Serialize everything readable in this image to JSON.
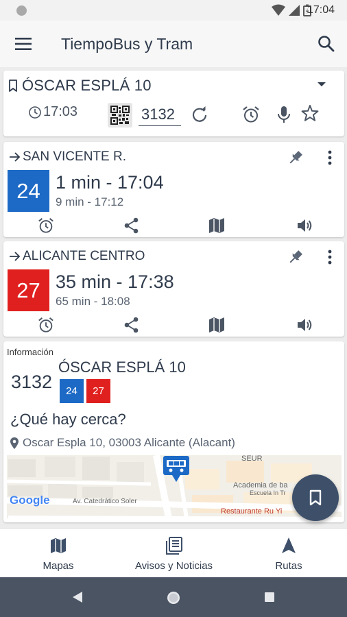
{
  "status_bar": {
    "time": "17:04"
  },
  "app_bar": {
    "title": "TiempoBus y Tram"
  },
  "stop": {
    "name": "ÓSCAR ESPLÁ 10",
    "time": "17:03",
    "code": "3132"
  },
  "lines": [
    {
      "number": "24",
      "color": "#1d6ac6",
      "destination": "SAN VICENTE R.",
      "next": "1 min - 17:04",
      "following": "9 min - 17:12"
    },
    {
      "number": "27",
      "color": "#e0201f",
      "destination": "ALICANTE CENTRO",
      "next": "35 min - 17:38",
      "following": "65 min - 18:08"
    }
  ],
  "info": {
    "label": "Información",
    "code": "3132",
    "stop_name": "ÓSCAR ESPLÁ 10",
    "nearby_title": "¿Qué hay cerca?",
    "address": "Oscar Espla 10, 03003 Alicante (Alacant)",
    "map": {
      "labels": {
        "seur": "SEUR",
        "academia": "Academia de ba",
        "escuela": "Escuela In Tr",
        "avenue": "Av. Catedrático Soler",
        "restaurant": "Restaurante Ru Yi"
      },
      "logo": "Google"
    }
  },
  "bottom_nav": {
    "maps": "Mapas",
    "news": "Avisos y Noticias",
    "routes": "Rutas"
  },
  "icons": {
    "menu": "menu-icon",
    "search": "search-icon",
    "bookmark": "bookmark-icon",
    "dropdown": "dropdown-icon",
    "clock": "clock-icon",
    "qr": "qr-code-icon",
    "refresh": "refresh-icon",
    "alarm": "alarm-icon",
    "mic": "microphone-icon",
    "star": "star-icon",
    "arrow": "arrow-right-icon",
    "pin": "pin-icon",
    "more": "more-vert-icon",
    "share": "share-icon",
    "map": "map-icon",
    "volume": "volume-icon",
    "location": "location-pin-icon",
    "bus": "bus-icon",
    "news": "news-icon",
    "navigation": "navigation-icon"
  }
}
